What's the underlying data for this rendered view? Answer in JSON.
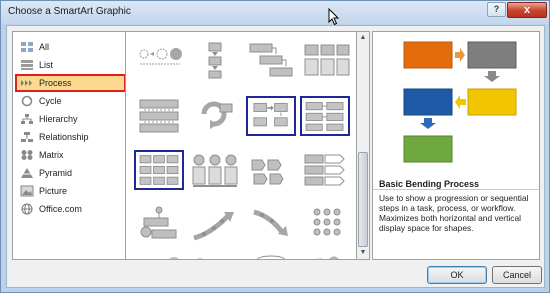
{
  "window": {
    "title": "Choose a SmartArt Graphic",
    "help_label": "?",
    "close_label": "x"
  },
  "categories": [
    {
      "label": "All",
      "icon": "all-icon"
    },
    {
      "label": "List",
      "icon": "list-icon"
    },
    {
      "label": "Process",
      "icon": "process-icon",
      "selected": true
    },
    {
      "label": "Cycle",
      "icon": "cycle-icon"
    },
    {
      "label": "Hierarchy",
      "icon": "hierarchy-icon"
    },
    {
      "label": "Relationship",
      "icon": "relationship-icon"
    },
    {
      "label": "Matrix",
      "icon": "matrix-icon"
    },
    {
      "label": "Pyramid",
      "icon": "pyramid-icon"
    },
    {
      "label": "Picture",
      "icon": "picture-icon"
    },
    {
      "label": "Office.com",
      "icon": "office-com-icon"
    }
  ],
  "preview": {
    "title": "Basic Bending Process",
    "description": "Use to show a progression or sequential steps in a task, process, or workflow. Maximizes both horizontal and vertical display space for shapes.",
    "colors": {
      "orange": "#e46c0a",
      "gray": "#7f7f7f",
      "blue": "#1f5aa6",
      "gold": "#f2c500",
      "green": "#6fa83f"
    }
  },
  "buttons": {
    "ok": "OK",
    "cancel": "Cancel"
  },
  "colors": {
    "selection_fill": "#fbd98f",
    "selection_border": "#e11d1d",
    "highlight_border": "#1f2896",
    "title_bar": "#c3d6ec"
  }
}
